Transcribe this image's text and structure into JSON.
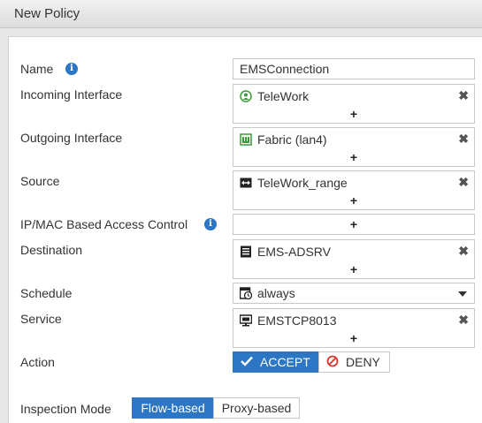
{
  "window": {
    "title": "New Policy"
  },
  "form": {
    "name": {
      "label": "Name",
      "value": "EMSConnection"
    },
    "incoming_interface": {
      "label": "Incoming Interface",
      "entry": "TeleWork",
      "entry_icon": "remote-user-icon"
    },
    "outgoing_interface": {
      "label": "Outgoing Interface",
      "entry": "Fabric (lan4)",
      "entry_icon": "port-icon"
    },
    "source": {
      "label": "Source",
      "entry": "TeleWork_range",
      "entry_icon": "address-range-icon"
    },
    "ipmac": {
      "label": "IP/MAC Based Access Control"
    },
    "destination": {
      "label": "Destination",
      "entry": "EMS-ADSRV",
      "entry_icon": "address-icon"
    },
    "schedule": {
      "label": "Schedule",
      "value": "always",
      "value_icon": "schedule-icon"
    },
    "service": {
      "label": "Service",
      "entry": "EMSTCP8013",
      "entry_icon": "service-icon"
    },
    "action": {
      "label": "Action",
      "accept": "ACCEPT",
      "deny": "DENY",
      "selected": "accept"
    },
    "inspection_mode": {
      "label": "Inspection Mode",
      "flow": "Flow-based",
      "proxy": "Proxy-based",
      "selected": "flow"
    }
  },
  "symbols": {
    "add": "+",
    "remove": "✖"
  },
  "colors": {
    "accent": "#2c76c4",
    "deny": "#d9342b",
    "port": "#3a9a3a"
  }
}
